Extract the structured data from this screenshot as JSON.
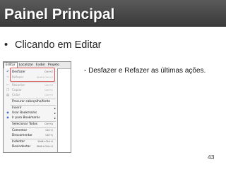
{
  "slide": {
    "title": "Painel Principal",
    "bullet": "Clicando em Editar",
    "annotation": "- Desfazer e Refazer as últimas ações.",
    "page_number": "43"
  },
  "menubar": {
    "items": [
      "Editar",
      "Localizar",
      "Exibir",
      "Projeto"
    ],
    "active": "Editar"
  },
  "edit_menu": [
    {
      "label": "Desfazer",
      "shortcut": "Ctrl+Z",
      "icon": "undo-icon",
      "disabled": false
    },
    {
      "label": "Refazer",
      "shortcut": "Shift+Ctrl+Z",
      "icon": "redo-icon",
      "disabled": true
    },
    {
      "label": "Recortar",
      "shortcut": "Ctrl+X",
      "icon": "cut-icon",
      "disabled": true
    },
    {
      "label": "Copiar",
      "shortcut": "Ctrl+C",
      "icon": "copy-icon",
      "disabled": true
    },
    {
      "label": "Colar",
      "shortcut": "Ctrl+V",
      "icon": "paste-icon",
      "disabled": true
    },
    {
      "label": "Procurar cabeçalho/fonte",
      "shortcut": "",
      "icon": "",
      "disabled": false
    },
    {
      "label": "Inserir",
      "shortcut": "",
      "icon": "",
      "disabled": false,
      "submenu": true
    },
    {
      "label": "Usar Bookmarks",
      "shortcut": "",
      "icon": "bookmark-icon",
      "disabled": false,
      "submenu": true
    },
    {
      "label": "Ir para Bookmarks",
      "shortcut": "",
      "icon": "goto-bookmark-icon",
      "disabled": false,
      "submenu": true
    },
    {
      "label": "Selecionar Todos",
      "shortcut": "Ctrl+A",
      "icon": "",
      "disabled": false
    },
    {
      "label": "Comentar",
      "shortcut": "Ctrl+/",
      "icon": "",
      "disabled": false
    },
    {
      "label": "Descomentar",
      "shortcut": "Ctrl+\\",
      "icon": "",
      "disabled": false
    },
    {
      "label": "Indentar",
      "shortcut": "Shift+Ctrl+I",
      "icon": "",
      "disabled": false
    },
    {
      "label": "Desindentar",
      "shortcut": "Shift+Ctrl+U",
      "icon": "",
      "disabled": false
    }
  ]
}
